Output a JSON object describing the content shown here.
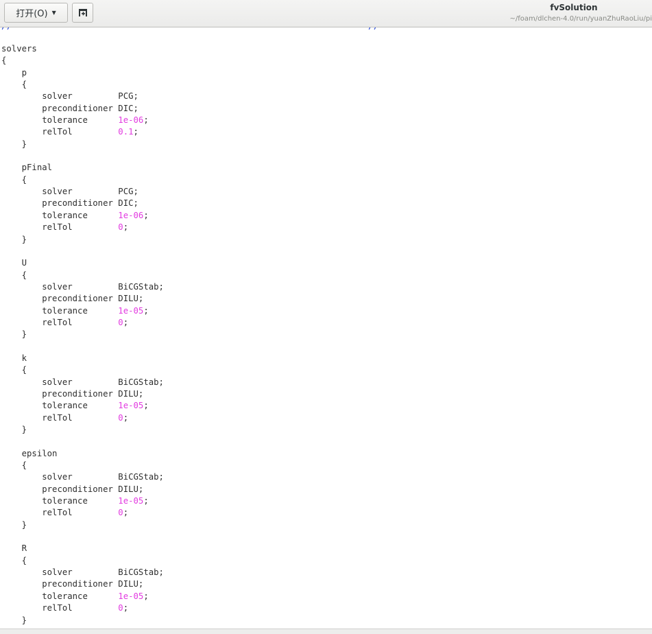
{
  "header": {
    "open_label": "打开(O)",
    "title": "fvSolution",
    "path": "~/foam/dlchen-4.0/run/yuanZhuRaoLiu/pi"
  },
  "editor": {
    "top_comment_left": "//",
    "top_comment_right": "//",
    "lines": [
      {
        "indent": "",
        "text": "solvers"
      },
      {
        "indent": "",
        "text": "{"
      },
      {
        "indent": "    ",
        "text": "p"
      },
      {
        "indent": "    ",
        "text": "{"
      },
      {
        "indent": "        ",
        "key": "solver         ",
        "val": "PCG;"
      },
      {
        "indent": "        ",
        "key": "preconditioner ",
        "val": "DIC;"
      },
      {
        "indent": "        ",
        "key": "tolerance      ",
        "num": "1e-06",
        "end": ";"
      },
      {
        "indent": "        ",
        "key": "relTol         ",
        "num": "0.1",
        "end": ";"
      },
      {
        "indent": "    ",
        "text": "}"
      },
      {
        "indent": "",
        "text": ""
      },
      {
        "indent": "    ",
        "text": "pFinal"
      },
      {
        "indent": "    ",
        "text": "{"
      },
      {
        "indent": "        ",
        "key": "solver         ",
        "val": "PCG;"
      },
      {
        "indent": "        ",
        "key": "preconditioner ",
        "val": "DIC;"
      },
      {
        "indent": "        ",
        "key": "tolerance      ",
        "num": "1e-06",
        "end": ";"
      },
      {
        "indent": "        ",
        "key": "relTol         ",
        "num": "0",
        "end": ";"
      },
      {
        "indent": "    ",
        "text": "}"
      },
      {
        "indent": "",
        "text": ""
      },
      {
        "indent": "    ",
        "text": "U"
      },
      {
        "indent": "    ",
        "text": "{"
      },
      {
        "indent": "        ",
        "key": "solver         ",
        "val": "BiCGStab;"
      },
      {
        "indent": "        ",
        "key": "preconditioner ",
        "val": "DILU;"
      },
      {
        "indent": "        ",
        "key": "tolerance      ",
        "num": "1e-05",
        "end": ";"
      },
      {
        "indent": "        ",
        "key": "relTol         ",
        "num": "0",
        "end": ";"
      },
      {
        "indent": "    ",
        "text": "}"
      },
      {
        "indent": "",
        "text": ""
      },
      {
        "indent": "    ",
        "text": "k"
      },
      {
        "indent": "    ",
        "text": "{"
      },
      {
        "indent": "        ",
        "key": "solver         ",
        "val": "BiCGStab;"
      },
      {
        "indent": "        ",
        "key": "preconditioner ",
        "val": "DILU;"
      },
      {
        "indent": "        ",
        "key": "tolerance      ",
        "num": "1e-05",
        "end": ";"
      },
      {
        "indent": "        ",
        "key": "relTol         ",
        "num": "0",
        "end": ";"
      },
      {
        "indent": "    ",
        "text": "}"
      },
      {
        "indent": "",
        "text": ""
      },
      {
        "indent": "    ",
        "text": "epsilon"
      },
      {
        "indent": "    ",
        "text": "{"
      },
      {
        "indent": "        ",
        "key": "solver         ",
        "val": "BiCGStab;"
      },
      {
        "indent": "        ",
        "key": "preconditioner ",
        "val": "DILU;"
      },
      {
        "indent": "        ",
        "key": "tolerance      ",
        "num": "1e-05",
        "end": ";"
      },
      {
        "indent": "        ",
        "key": "relTol         ",
        "num": "0",
        "end": ";"
      },
      {
        "indent": "    ",
        "text": "}"
      },
      {
        "indent": "",
        "text": ""
      },
      {
        "indent": "    ",
        "text": "R"
      },
      {
        "indent": "    ",
        "text": "{"
      },
      {
        "indent": "        ",
        "key": "solver         ",
        "val": "BiCGStab;"
      },
      {
        "indent": "        ",
        "key": "preconditioner ",
        "val": "DILU;"
      },
      {
        "indent": "        ",
        "key": "tolerance      ",
        "num": "1e-05",
        "end": ";"
      },
      {
        "indent": "        ",
        "key": "relTol         ",
        "num": "0",
        "end": ";"
      },
      {
        "indent": "    ",
        "text": "}"
      }
    ]
  },
  "colors": {
    "number": "#e23be0",
    "comment": "#1a3ed4",
    "text": "#2e2e2e"
  },
  "icons": {
    "open_menu": "chevron-down-icon",
    "new_tab": "new-tab-icon"
  }
}
